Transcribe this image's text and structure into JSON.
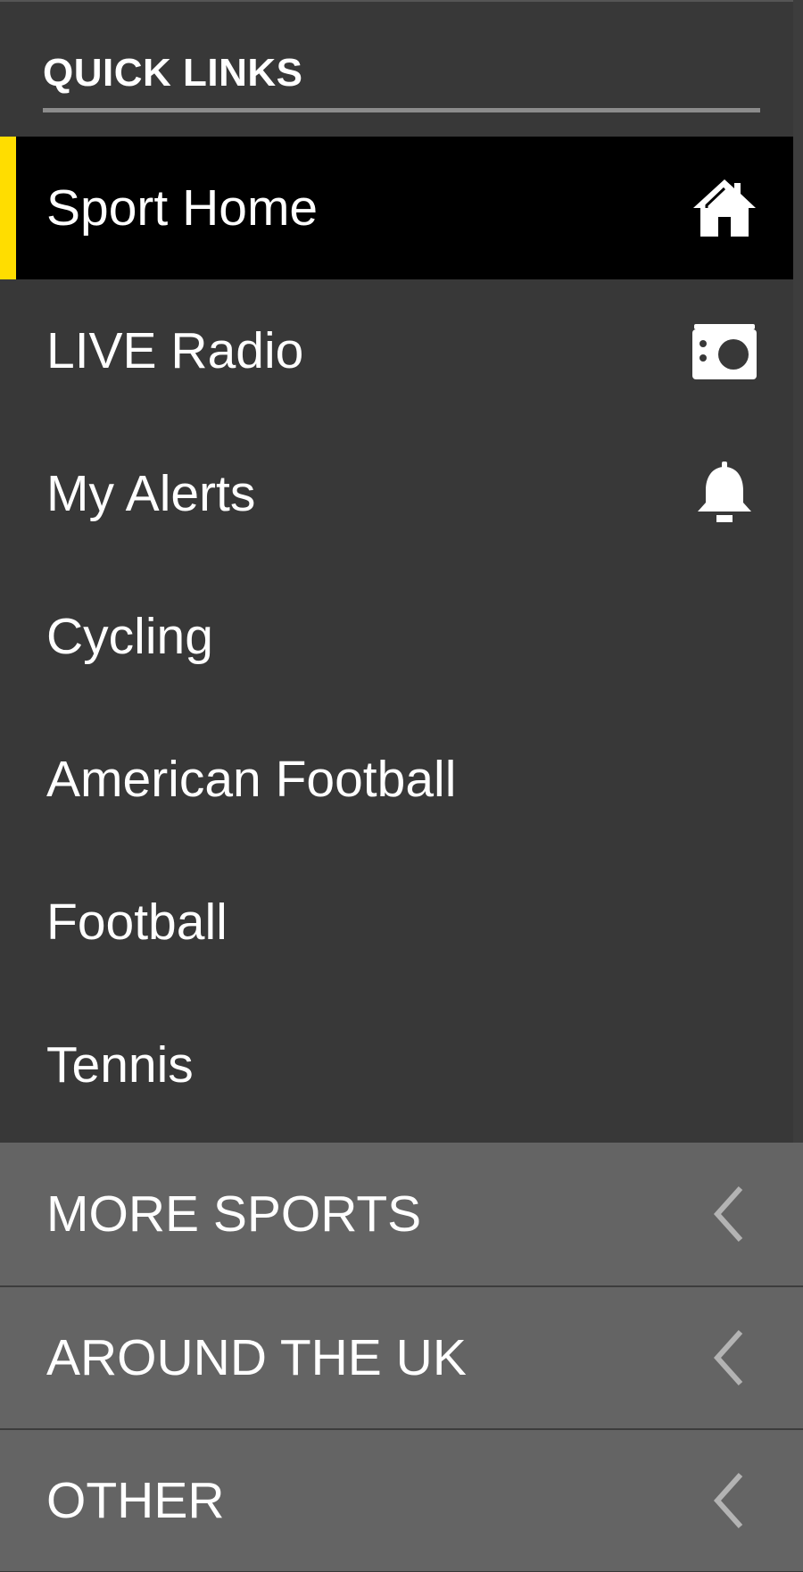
{
  "drawer": {
    "header": {
      "title": "QUICK LINKS"
    },
    "items": [
      {
        "label": "Sport Home",
        "icon": "home-icon",
        "active": true
      },
      {
        "label": "LIVE Radio",
        "icon": "radio-icon"
      },
      {
        "label": "My Alerts",
        "icon": "bell-icon"
      },
      {
        "label": "Cycling"
      },
      {
        "label": "American Football"
      },
      {
        "label": "Football"
      },
      {
        "label": "Tennis"
      }
    ],
    "sections": [
      {
        "label": "MORE SPORTS",
        "icon": "chevron-left-icon"
      },
      {
        "label": "AROUND THE UK",
        "icon": "chevron-left-icon"
      },
      {
        "label": "OTHER",
        "icon": "chevron-left-icon"
      }
    ]
  },
  "colors": {
    "background": "#383838",
    "active_background": "#000000",
    "accent": "#ffdd00",
    "section_background": "#646464",
    "text": "#ffffff"
  }
}
